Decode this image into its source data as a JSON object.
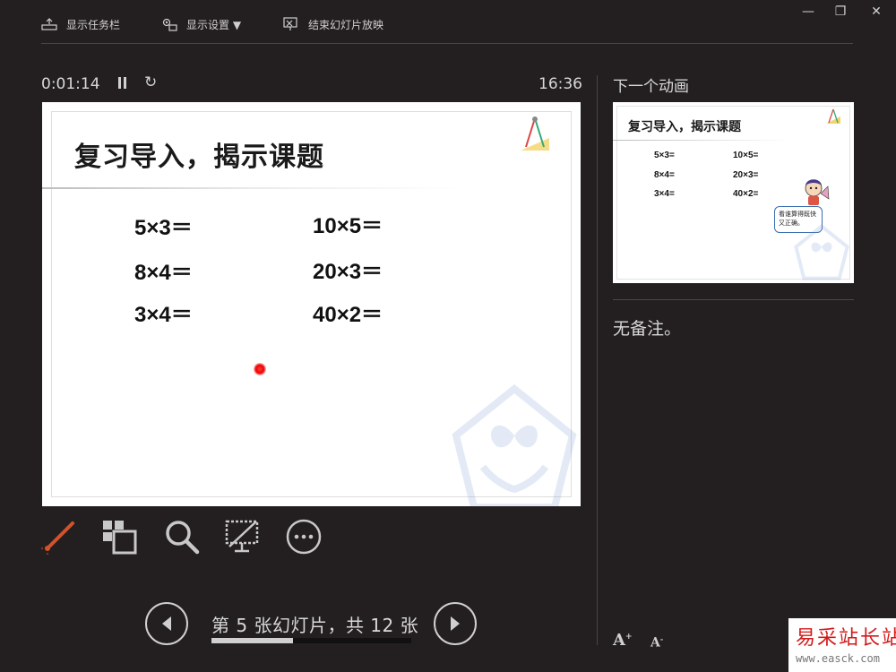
{
  "toolbar": {
    "show_taskbar": "显示任务栏",
    "display_settings": "显示设置 ▼",
    "end_slideshow": "结束幻灯片放映"
  },
  "window_controls": {
    "minimize": "—",
    "restore": "❐",
    "close": "✕"
  },
  "timer": {
    "elapsed": "0:01:14",
    "clock": "16:36"
  },
  "current_slide": {
    "title": "复习导入，揭示课题",
    "equations_left": [
      "5×3＝",
      "8×4＝",
      "3×4＝"
    ],
    "equations_right": [
      "10×5＝",
      "20×3＝",
      "40×2＝"
    ]
  },
  "tools": [
    "pen-laser-icon",
    "slide-grid-icon",
    "zoom-icon",
    "black-screen-icon",
    "more-icon"
  ],
  "navigation": {
    "counter": "第 5 张幻灯片，共 12 张",
    "current": 5,
    "total": 12,
    "progress_fraction": 0.41
  },
  "next_pane": {
    "label": "下一个动画",
    "title": "复习导入，揭示课题",
    "equations_left": [
      "5×3=",
      "8×4=",
      "3×4="
    ],
    "equations_right": [
      "10×5=",
      "20×3=",
      "40×2="
    ],
    "bubble_text": "看谁算得既快又正确。"
  },
  "notes": "无备注。",
  "font_controls": {
    "increase": "A",
    "decrease": "A"
  },
  "site": {
    "name": "易采站长站",
    "url": "www.easck.com"
  },
  "colors": {
    "pen_accent": "#d2522a",
    "background": "#231f20",
    "laser": "#ff2020"
  }
}
